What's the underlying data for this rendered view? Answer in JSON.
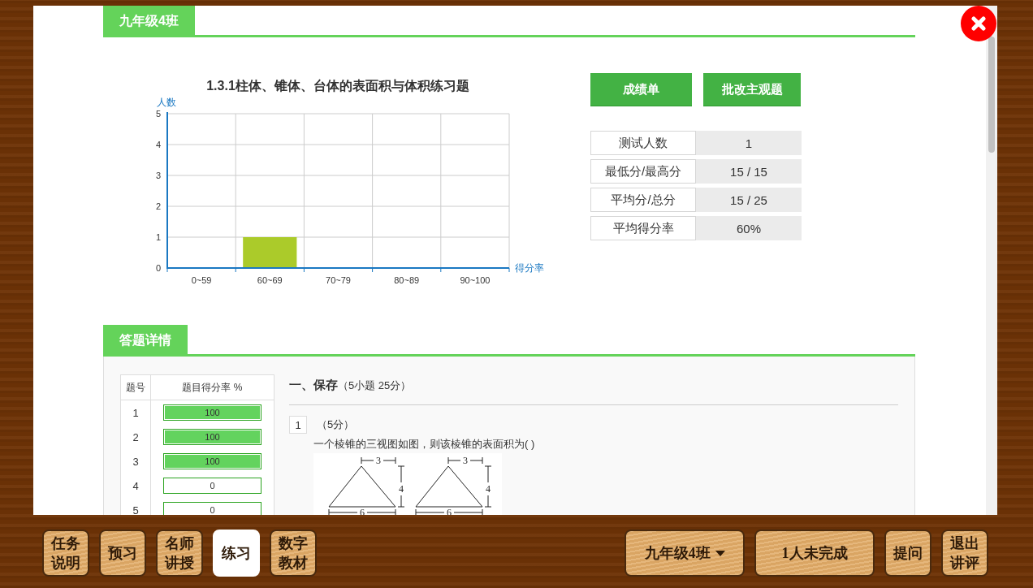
{
  "class_tab": {
    "label": "九年级4班"
  },
  "chart": {
    "chart_data": {
      "type": "bar",
      "grid": true,
      "title": "1.3.1柱体、锥体、台体的表面积与体积练习题",
      "xlabel": "得分率",
      "ylabel": "人数",
      "categories": [
        "0~59",
        "60~69",
        "70~79",
        "80~89",
        "90~100"
      ],
      "values": [
        0,
        1,
        0,
        0,
        0
      ],
      "ylim": [
        0,
        5
      ],
      "yticks": [
        0,
        1,
        2,
        3,
        4,
        5
      ]
    }
  },
  "actions": [
    {
      "label": "成绩单"
    },
    {
      "label": "批改主观题"
    }
  ],
  "stats": [
    {
      "label": "测试人数",
      "value": "1"
    },
    {
      "label": "最低分/最高分",
      "value": "15 / 15"
    },
    {
      "label": "平均分/总分",
      "value": "15 / 25"
    },
    {
      "label": "平均得分率",
      "value": "60%"
    }
  ],
  "details_tab": {
    "label": "答题详情"
  },
  "question_table": {
    "columns": [
      "题号",
      "题目得分率 %"
    ],
    "rows": [
      {
        "number": "1",
        "rate": "100",
        "level": 1
      },
      {
        "number": "2",
        "rate": "100",
        "level": 1
      },
      {
        "number": "3",
        "rate": "100",
        "level": 1
      },
      {
        "number": "4",
        "rate": "0",
        "level": 0
      },
      {
        "number": "5",
        "rate": "0",
        "level": 0
      }
    ]
  },
  "section": {
    "title": "一、保存",
    "summary": "（5小题 25分）"
  },
  "question": {
    "number": "1",
    "score": "（5分）",
    "text": "一个棱锥的三视图如图，则该棱锥的表面积为(      )",
    "figure_labels": [
      "3",
      "4",
      "6",
      "3",
      "4",
      "6"
    ]
  },
  "toolbar": {
    "left": [
      {
        "lines": [
          "任务",
          "说明"
        ],
        "selected": false
      },
      {
        "lines": [
          "预习"
        ],
        "selected": false
      },
      {
        "lines": [
          "名师",
          "讲授"
        ],
        "selected": false
      },
      {
        "lines": [
          "练习"
        ],
        "selected": true
      },
      {
        "lines": [
          "数字",
          "教材"
        ],
        "selected": false
      }
    ],
    "right": [
      {
        "kind": "dropdown",
        "lines": [
          "九年级4班"
        ]
      },
      {
        "kind": "status",
        "lines": [
          "1人未完成"
        ]
      },
      {
        "kind": "button",
        "lines": [
          "提问"
        ]
      },
      {
        "kind": "button",
        "lines": [
          "退出",
          "讲评"
        ]
      }
    ]
  }
}
